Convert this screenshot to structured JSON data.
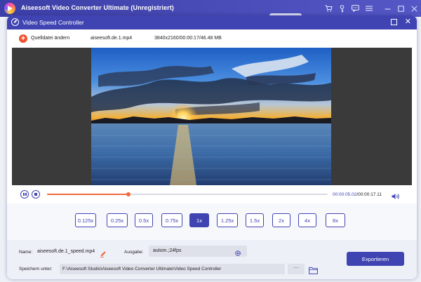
{
  "app": {
    "title": "Aiseesoft Video Converter Ultimate (Unregistriert)"
  },
  "dialog": {
    "title": "Video Speed Controller"
  },
  "file_bar": {
    "source_button": "Quelldatei ändern",
    "file_name": "aiseesoft.de.1.mp4",
    "file_meta": "3840x2160/00:00:17/46.48 MB"
  },
  "playback": {
    "current_time": "00:00:05.02",
    "total_time": "/00:00:17.11",
    "progress": 0.29
  },
  "speeds": [
    "0.125x",
    "0.25x",
    "0.5x",
    "0.75x",
    "1x",
    "1.25x",
    "1.5x",
    "2x",
    "4x",
    "8x"
  ],
  "selected_speed": "1x",
  "bottom": {
    "name_label": "Name:",
    "name_value": "aiseesoft.de.1_speed.mp4",
    "output_label": "Ausgabe:",
    "output_value": "autom.;24fps",
    "save_label": "Speichern unter:",
    "save_path": "F:\\Aiseesoft Studio\\Aiseesoft Video Converter Ultimate\\Video Speed Controller",
    "more_label": "···",
    "export_label": "Exportieren"
  },
  "colors": {
    "accent": "#3f44b2",
    "progress": "#f06a3c",
    "add": "#f0532f"
  }
}
